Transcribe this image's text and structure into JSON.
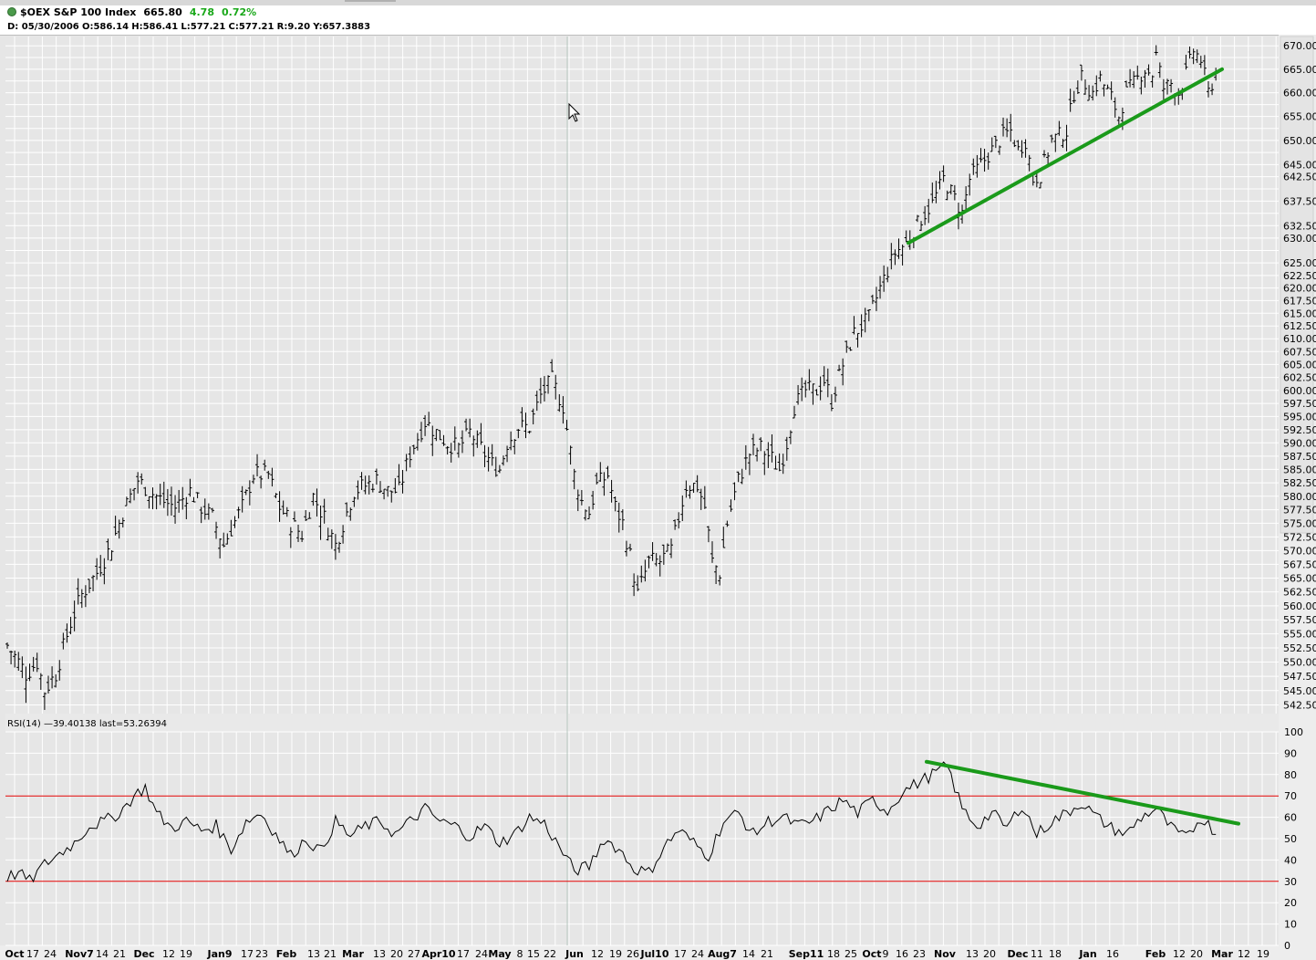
{
  "header": {
    "symbol": "$OEX S&P 100 Index",
    "last": "665.80",
    "change": "4.78",
    "change_pct": "0.72%",
    "bar_info": {
      "date": "D: 05/30/2006",
      "open": "O:586.14",
      "high": "H:586.41",
      "low": "L:577.21",
      "close": "C:577.21",
      "range": "R:9.20",
      "y": "Y:657.3883"
    }
  },
  "rsi_label": "RSI(14) —39.40138 last=53.26394",
  "colors": {
    "background": "#e6e6e6",
    "grid": "#ffffff",
    "bars": "#000000",
    "trendline": "#1a9a1a",
    "rsi_band": "#e00000",
    "rsi_line": "#000000"
  },
  "chart_data": [
    {
      "type": "ohlc",
      "series": [
        {
          "name": "$OEX S&P 100 Index",
          "anchors": [
            [
              0,
              553
            ],
            [
              5,
              548
            ],
            [
              8,
              550
            ],
            [
              10,
              545
            ],
            [
              13,
              548
            ],
            [
              17,
              557
            ],
            [
              20,
              562
            ],
            [
              24,
              566
            ],
            [
              28,
              571
            ],
            [
              31,
              577
            ],
            [
              35,
              583
            ],
            [
              38,
              581
            ],
            [
              42,
              579
            ],
            [
              45,
              578
            ],
            [
              49,
              581
            ],
            [
              52,
              578
            ],
            [
              55,
              576
            ],
            [
              58,
              571
            ],
            [
              60,
              574
            ],
            [
              63,
              578
            ],
            [
              66,
              584
            ],
            [
              70,
              584
            ],
            [
              73,
              578
            ],
            [
              76,
              575
            ],
            [
              79,
              573
            ],
            [
              82,
              580
            ],
            [
              85,
              576
            ],
            [
              88,
              571
            ],
            [
              90,
              575
            ],
            [
              93,
              581
            ],
            [
              96,
              582
            ],
            [
              99,
              583
            ],
            [
              102,
              581
            ],
            [
              105,
              581
            ],
            [
              108,
              588
            ],
            [
              112,
              594
            ],
            [
              115,
              592
            ],
            [
              118,
              590
            ],
            [
              121,
              589
            ],
            [
              124,
              592
            ],
            [
              127,
              589
            ],
            [
              130,
              586
            ],
            [
              132,
              585
            ],
            [
              134,
              590
            ],
            [
              137,
              593
            ],
            [
              140,
              593
            ],
            [
              143,
              599
            ],
            [
              146,
              602
            ],
            [
              149,
              597
            ],
            [
              152,
              584
            ],
            [
              154,
              579
            ],
            [
              156,
              577
            ],
            [
              158,
              582
            ],
            [
              161,
              584
            ],
            [
              163,
              578
            ],
            [
              165,
              575
            ],
            [
              167,
              569
            ],
            [
              169,
              562
            ],
            [
              172,
              568
            ],
            [
              175,
              568
            ],
            [
              178,
              570
            ],
            [
              182,
              582
            ],
            [
              185,
              582
            ],
            [
              187,
              578
            ],
            [
              189,
              568
            ],
            [
              191,
              566
            ],
            [
              193,
              575
            ],
            [
              196,
              583
            ],
            [
              199,
              588
            ],
            [
              202,
              589
            ],
            [
              205,
              587
            ],
            [
              207,
              585
            ],
            [
              209,
              590
            ],
            [
              211,
              597
            ],
            [
              214,
              600
            ],
            [
              217,
              600
            ],
            [
              219,
              602
            ],
            [
              221,
              598
            ],
            [
              224,
              605
            ],
            [
              227,
              611
            ],
            [
              231,
              614
            ],
            [
              234,
              620
            ],
            [
              238,
              627
            ],
            [
              241,
              629
            ],
            [
              245,
              634
            ],
            [
              248,
              637
            ],
            [
              251,
              642
            ],
            [
              254,
              638
            ],
            [
              256,
              635
            ],
            [
              258,
              642
            ],
            [
              261,
              645
            ],
            [
              264,
              648
            ],
            [
              267,
              651
            ],
            [
              269,
              652
            ],
            [
              271,
              648
            ],
            [
              273,
              650
            ],
            [
              275,
              642
            ],
            [
              277,
              643
            ],
            [
              280,
              650
            ],
            [
              284,
              652
            ],
            [
              286,
              660
            ],
            [
              288,
              663
            ],
            [
              291,
              660
            ],
            [
              293,
              663
            ],
            [
              296,
              659
            ],
            [
              298,
              655
            ],
            [
              300,
              660
            ],
            [
              302,
              662
            ],
            [
              305,
              665
            ],
            [
              307,
              664
            ],
            [
              308,
              668
            ],
            [
              310,
              661
            ],
            [
              312,
              662
            ],
            [
              314,
              660
            ],
            [
              316,
              664
            ],
            [
              318,
              669
            ],
            [
              320,
              667
            ],
            [
              322,
              660
            ],
            [
              324,
              664
            ]
          ]
        }
      ],
      "x_tick_labels": [
        "Oct",
        "17",
        "24",
        "Nov7",
        "14",
        "21",
        "Dec",
        "12",
        "19",
        "Jan9",
        "17",
        "23",
        "Feb",
        "13",
        "21",
        "Mar",
        "13",
        "20",
        "27",
        "Apr10",
        "17",
        "24",
        "May",
        "8",
        "15",
        "22",
        "Jun",
        "12",
        "19",
        "26",
        "Jul10",
        "17",
        "24",
        "Aug7",
        "14",
        "21",
        "Sep11",
        "18",
        "25",
        "Oct",
        "9",
        "16",
        "23",
        "Nov",
        "13",
        "20",
        "Dec",
        "11",
        "18",
        "Jan",
        "16",
        "Feb",
        "12",
        "20",
        "Mar",
        "12",
        "19"
      ],
      "y_tick_labels": [
        "542.50",
        "545.00",
        "547.50",
        "550.00",
        "552.50",
        "555.00",
        "557.50",
        "560.00",
        "562.50",
        "565.00",
        "567.50",
        "570.00",
        "572.50",
        "575.00",
        "577.50",
        "580.00",
        "582.50",
        "585.00",
        "587.50",
        "590.00",
        "592.50",
        "595.00",
        "597.50",
        "600.00",
        "602.50",
        "605.00",
        "607.50",
        "610.00",
        "612.50",
        "615.00",
        "617.50",
        "620.00",
        "622.50",
        "625.00",
        "630.00",
        "632.50",
        "637.50",
        "642.50",
        "645.00",
        "650.00",
        "655.00",
        "660.00",
        "665.00",
        "670.00"
      ],
      "y_scale": "log",
      "ylim": [
        541,
        672
      ],
      "grid": true,
      "trendline": [
        [
          676,
          629
        ],
        [
          912,
          665
        ]
      ]
    },
    {
      "type": "line",
      "series": [
        {
          "name": "RSI(14)",
          "anchors": [
            [
              0,
              32
            ],
            [
              3,
              34
            ],
            [
              6,
              30
            ],
            [
              10,
              38
            ],
            [
              14,
              43
            ],
            [
              18,
              48
            ],
            [
              22,
              56
            ],
            [
              26,
              58
            ],
            [
              30,
              62
            ],
            [
              34,
              70
            ],
            [
              37,
              74
            ],
            [
              40,
              62
            ],
            [
              44,
              55
            ],
            [
              48,
              58
            ],
            [
              52,
              54
            ],
            [
              56,
              56
            ],
            [
              60,
              45
            ],
            [
              64,
              58
            ],
            [
              68,
              62
            ],
            [
              72,
              52
            ],
            [
              76,
              42
            ],
            [
              80,
              50
            ],
            [
              84,
              44
            ],
            [
              88,
              58
            ],
            [
              92,
              51
            ],
            [
              96,
              56
            ],
            [
              100,
              58
            ],
            [
              104,
              52
            ],
            [
              108,
              58
            ],
            [
              112,
              64
            ],
            [
              116,
              58
            ],
            [
              120,
              56
            ],
            [
              124,
              51
            ],
            [
              128,
              56
            ],
            [
              132,
              48
            ],
            [
              136,
              52
            ],
            [
              140,
              60
            ],
            [
              144,
              57
            ],
            [
              148,
              46
            ],
            [
              152,
              35
            ],
            [
              156,
              37
            ],
            [
              160,
              50
            ],
            [
              164,
              45
            ],
            [
              168,
              36
            ],
            [
              172,
              34
            ],
            [
              176,
              46
            ],
            [
              180,
              54
            ],
            [
              184,
              48
            ],
            [
              188,
              42
            ],
            [
              192,
              58
            ],
            [
              196,
              62
            ],
            [
              200,
              52
            ],
            [
              204,
              58
            ],
            [
              208,
              60
            ],
            [
              212,
              56
            ],
            [
              216,
              58
            ],
            [
              220,
              63
            ],
            [
              224,
              68
            ],
            [
              228,
              62
            ],
            [
              232,
              68
            ],
            [
              236,
              63
            ],
            [
              240,
              72
            ],
            [
              244,
              76
            ],
            [
              248,
              80
            ],
            [
              252,
              84
            ],
            [
              256,
              64
            ],
            [
              260,
              56
            ],
            [
              264,
              62
            ],
            [
              268,
              55
            ],
            [
              272,
              66
            ],
            [
              276,
              52
            ],
            [
              280,
              58
            ],
            [
              284,
              62
            ],
            [
              288,
              67
            ],
            [
              292,
              60
            ],
            [
              296,
              55
            ],
            [
              300,
              52
            ],
            [
              304,
              60
            ],
            [
              308,
              64
            ],
            [
              312,
              55
            ],
            [
              316,
              50
            ],
            [
              320,
              60
            ],
            [
              324,
              53
            ]
          ]
        }
      ],
      "y_tick_labels": [
        "0",
        "10",
        "20",
        "30",
        "40",
        "50",
        "60",
        "70",
        "80",
        "90",
        "100"
      ],
      "ylim": [
        0,
        100
      ],
      "bands": [
        30,
        70
      ],
      "trendline": [
        [
          694,
          86
        ],
        [
          932,
          57
        ]
      ]
    }
  ]
}
